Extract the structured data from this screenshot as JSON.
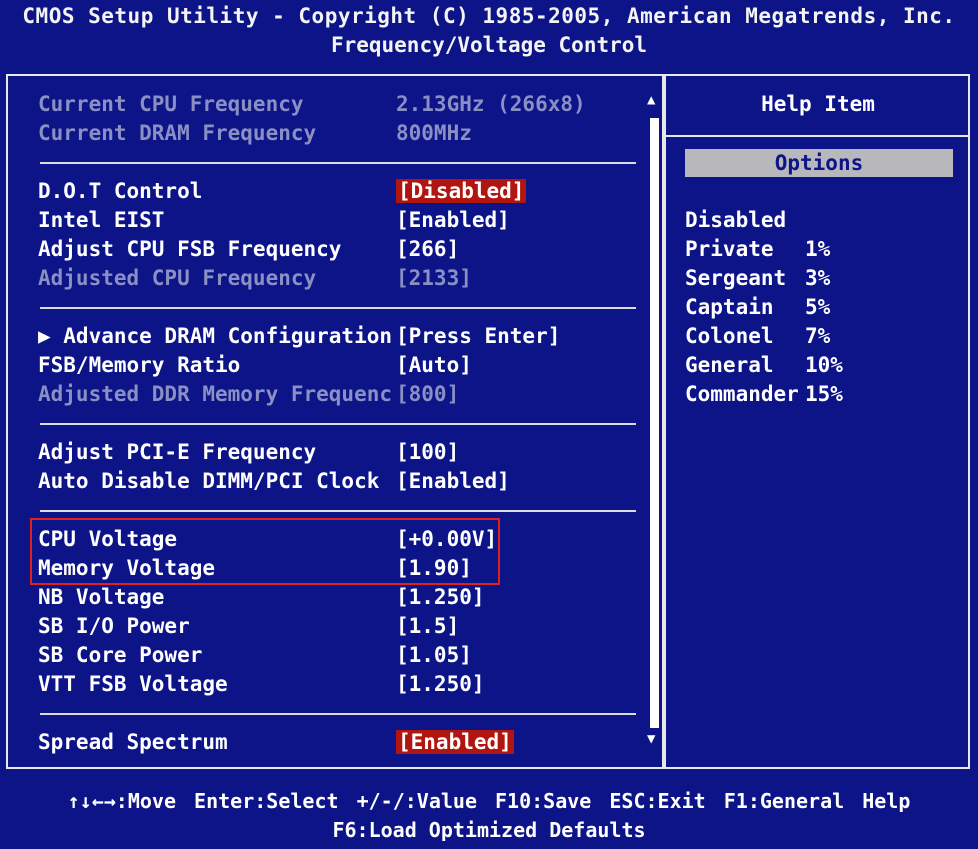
{
  "header": {
    "line1": "CMOS Setup Utility - Copyright (C) 1985-2005, American Megatrends, Inc.",
    "line2": "Frequency/Voltage Control"
  },
  "settings": {
    "current_cpu_freq": {
      "label": "Current CPU Frequency",
      "value": "2.13GHz (266x8)"
    },
    "current_dram_freq": {
      "label": "Current DRAM Frequency",
      "value": "800MHz"
    },
    "dot_control": {
      "label": "D.O.T Control",
      "value": "[Disabled]"
    },
    "intel_eist": {
      "label": "Intel EIST",
      "value": "[Enabled]"
    },
    "adjust_cpu_fsb": {
      "label": "Adjust CPU FSB Frequency",
      "value": "[266]"
    },
    "adjusted_cpu_freq": {
      "label": "Adjusted CPU Frequency",
      "value": "[2133]"
    },
    "advance_dram": {
      "label": "▶ Advance DRAM Configuration",
      "value": "[Press Enter]"
    },
    "fsb_memory_ratio": {
      "label": "FSB/Memory Ratio",
      "value": "[Auto]"
    },
    "adjusted_ddr": {
      "label": "Adjusted DDR Memory Frequenc",
      "value": "[800]"
    },
    "adjust_pcie": {
      "label": "Adjust PCI-E Frequency",
      "value": "[100]"
    },
    "auto_disable_dimm": {
      "label": "Auto Disable DIMM/PCI Clock",
      "value": "[Enabled]"
    },
    "cpu_voltage": {
      "label": "CPU Voltage",
      "value": "[+0.00V]"
    },
    "memory_voltage": {
      "label": "Memory Voltage",
      "value": "[1.90]"
    },
    "nb_voltage": {
      "label": "NB Voltage",
      "value": "[1.250]"
    },
    "sb_io_power": {
      "label": "SB I/O Power",
      "value": "[1.5]"
    },
    "sb_core_power": {
      "label": "SB Core Power",
      "value": "[1.05]"
    },
    "vtt_fsb_voltage": {
      "label": "VTT FSB Voltage",
      "value": "[1.250]"
    },
    "spread_spectrum": {
      "label": "Spread Spectrum",
      "value": "[Enabled]"
    }
  },
  "help": {
    "title": "Help Item",
    "options_label": "Options",
    "items": [
      {
        "name": "Disabled",
        "pct": ""
      },
      {
        "name": "Private",
        "pct": "1%"
      },
      {
        "name": "Sergeant",
        "pct": "3%"
      },
      {
        "name": "Captain",
        "pct": "5%"
      },
      {
        "name": "Colonel",
        "pct": "7%"
      },
      {
        "name": "General",
        "pct": "10%"
      },
      {
        "name": "Commander",
        "pct": "15%"
      }
    ]
  },
  "footer": {
    "line1": "↑↓←→:Move Enter:Select +/-/:Value F10:Save ESC:Exit F1:General Help",
    "line2": "F6:Load Optimized Defaults"
  },
  "icons": {
    "scroll_up": "up-triangle",
    "scroll_down": "down-triangle"
  },
  "colors": {
    "background": "#0c1487",
    "selection": "#b0160f",
    "dim_text": "#8a8fc4",
    "highlight_border": "#e0201c"
  }
}
